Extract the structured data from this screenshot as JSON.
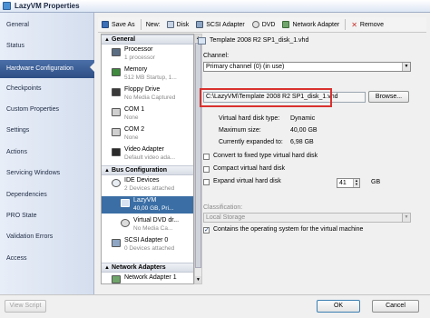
{
  "window": {
    "title": "LazyVM Properties"
  },
  "nav": {
    "items": [
      {
        "label": "General"
      },
      {
        "label": "Status"
      },
      {
        "label": "Hardware Configuration"
      },
      {
        "label": "Checkpoints"
      },
      {
        "label": "Custom Properties"
      },
      {
        "label": "Settings"
      },
      {
        "label": "Actions"
      },
      {
        "label": "Servicing Windows"
      },
      {
        "label": "Dependencies"
      },
      {
        "label": "PRO State"
      },
      {
        "label": "Validation Errors"
      },
      {
        "label": "Access"
      }
    ]
  },
  "toolbar": {
    "save_as": "Save As",
    "new_label": "New:",
    "disk": "Disk",
    "scsi_adapter": "SCSI Adapter",
    "dvd": "DVD",
    "network_adapter": "Network Adapter",
    "remove": "Remove"
  },
  "tree": {
    "general_header": "General",
    "processor": {
      "name": "Processor",
      "sub": "1 processor"
    },
    "memory": {
      "name": "Memory",
      "sub": "512 MB Startup, 1..."
    },
    "floppy": {
      "name": "Floppy Drive",
      "sub": "No Media Captured"
    },
    "com1": {
      "name": "COM 1",
      "sub": "None"
    },
    "com2": {
      "name": "COM 2",
      "sub": "None"
    },
    "video": {
      "name": "Video Adapter",
      "sub": "Default video ada..."
    },
    "bus_header": "Bus Configuration",
    "ide": {
      "name": "IDE Devices",
      "sub": "2 Devices attached"
    },
    "lazyvm": {
      "name": "LazyVM",
      "sub": "40,00 GB, Pri..."
    },
    "dvd": {
      "name": "Virtual DVD dr...",
      "sub": "No Media Ca..."
    },
    "scsi": {
      "name": "SCSI Adapter 0",
      "sub": "0 Devices attached"
    },
    "net_header": "Network Adapters",
    "net1": {
      "name": "Network Adapter 1"
    }
  },
  "details": {
    "header": "Template 2008 R2 SP1_disk_1.vhd",
    "channel_label": "Channel:",
    "channel_value": "Primary channel (0) (in use)",
    "path_value": "C:\\LazyVM\\Template 2008 R2 SP1_disk_1.vhd",
    "browse": "Browse...",
    "info": {
      "type_label": "Virtual hard disk type:",
      "type_value": "Dynamic",
      "max_label": "Maximum size:",
      "max_value": "40,00 GB",
      "current_label": "Currently expanded to:",
      "current_value": "6,98 GB"
    },
    "convert_label": "Convert to fixed type virtual hard disk",
    "compact_label": "Compact virtual hard disk",
    "expand_label": "Expand virtual hard disk",
    "expand_value": "41",
    "expand_unit": "GB",
    "classification_label": "Classification:",
    "classification_value": "Local Storage",
    "contains_os_label": "Contains the operating system for the virtual machine"
  },
  "footer": {
    "view_script": "View Script",
    "ok": "OK",
    "cancel": "Cancel"
  },
  "colors": {
    "nav_selected": "#3a5a93",
    "tree_selected": "#3a6ea5",
    "highlight_frame": "#d9312e"
  }
}
